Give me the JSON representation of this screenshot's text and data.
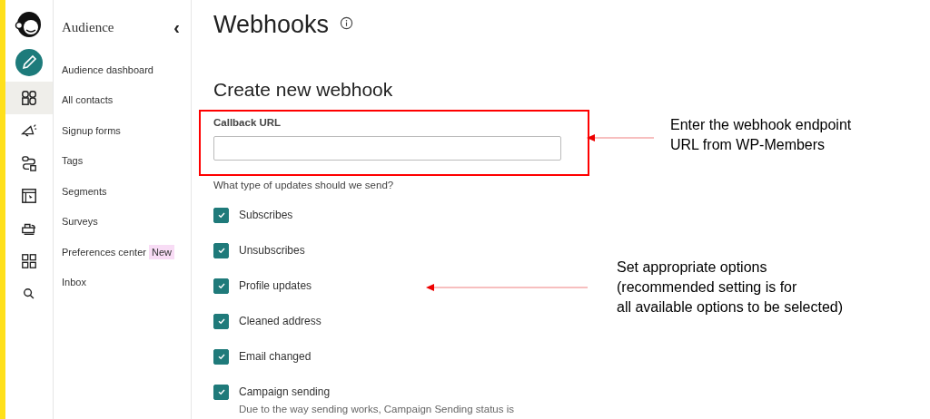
{
  "rail": {
    "items": [
      {
        "kind": "create",
        "selected": false
      },
      {
        "kind": "audience",
        "selected": true
      },
      {
        "kind": "campaigns",
        "selected": false
      },
      {
        "kind": "automations",
        "selected": false
      },
      {
        "kind": "website",
        "selected": false
      },
      {
        "kind": "content",
        "selected": false
      },
      {
        "kind": "integrations",
        "selected": false
      },
      {
        "kind": "search",
        "selected": false
      }
    ]
  },
  "nav": {
    "title": "Audience",
    "collapse": "‹",
    "items": [
      {
        "label": "Audience dashboard"
      },
      {
        "label": "All contacts"
      },
      {
        "label": "Signup forms"
      },
      {
        "label": "Tags"
      },
      {
        "label": "Segments"
      },
      {
        "label": "Surveys"
      },
      {
        "label": "Preferences center",
        "badge": "New"
      },
      {
        "label": "Inbox"
      }
    ]
  },
  "page": {
    "title": "Webhooks",
    "section": "Create new webhook",
    "callback_label": "Callback URL",
    "question": "What type of updates should we send?",
    "options": [
      {
        "label": "Subscribes",
        "checked": true
      },
      {
        "label": "Unsubscribes",
        "checked": true
      },
      {
        "label": "Profile updates",
        "checked": true
      },
      {
        "label": "Cleaned address",
        "checked": true
      },
      {
        "label": "Email changed",
        "checked": true
      },
      {
        "label": "Campaign sending",
        "checked": true,
        "note": "Due to the way sending works, Campaign Sending status is"
      }
    ]
  },
  "annotations": [
    {
      "lines": [
        "Enter the webhook endpoint",
        "URL from WP-Members"
      ]
    },
    {
      "lines": [
        "Set appropriate options",
        "(recommended setting is for",
        "all available options to be selected)"
      ]
    }
  ]
}
